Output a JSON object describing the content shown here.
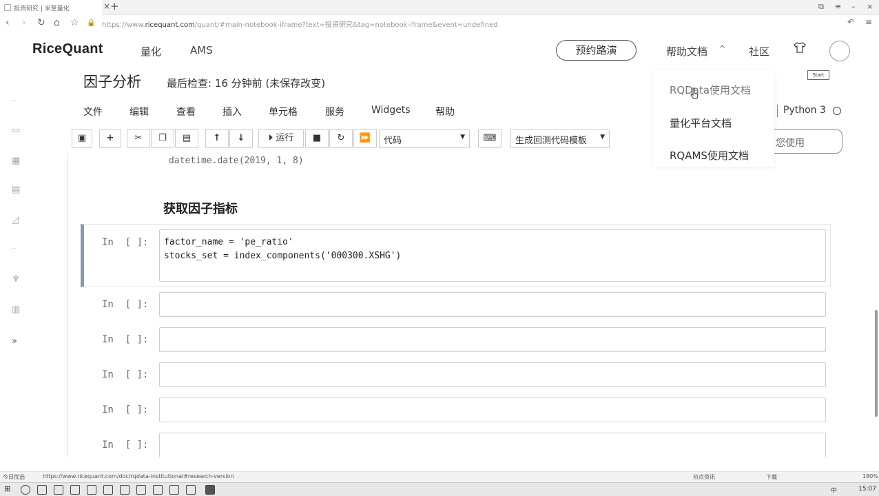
{
  "browser": {
    "tab_title": "投资研究 | 米筐量化",
    "url_prefix": "https://www.",
    "url_host": "ricequant.com",
    "url_path": "/quant/#main-notebook-iframe?text=投资研究&tag=notebook-iframe&event=undefined"
  },
  "site": {
    "logo": "RiceQuant",
    "nav": [
      "量化",
      "AMS"
    ],
    "book_button": "预约路演",
    "help": "帮助文档",
    "community": "社区",
    "start_tip": "Start"
  },
  "help_dropdown": {
    "items": [
      "RQData使用文档",
      "量化平台文档",
      "RQAMS使用文档"
    ]
  },
  "notebook": {
    "title": "因子分析",
    "checkpoint": "最后检查: 16 分钟前  (未保存改变)",
    "menu": [
      "文件",
      "编辑",
      "查看",
      "插入",
      "单元格",
      "服务",
      "Widgets",
      "帮助"
    ],
    "kernel": "Python 3",
    "use_button": "您使用",
    "toolbar": {
      "run_label": "运行",
      "cell_type": "代码",
      "template": "生成回测代码模板"
    },
    "prev_code": "datetime.date(2019, 1, 8)",
    "heading": "获取因子指标",
    "prompt": "In  [ ]:",
    "code_lines": [
      "factor_name = 'pe_ratio'",
      "stocks_set = index_components('000300.XSHG')"
    ]
  },
  "status": {
    "left_label": "今日优选",
    "link": "https://www.ricequant.com/doc/rqdata-institutional#research-version",
    "right": [
      "热点资讯",
      "下载",
      "180%"
    ]
  },
  "taskbar": {
    "ime": "中",
    "time": "15:07"
  }
}
